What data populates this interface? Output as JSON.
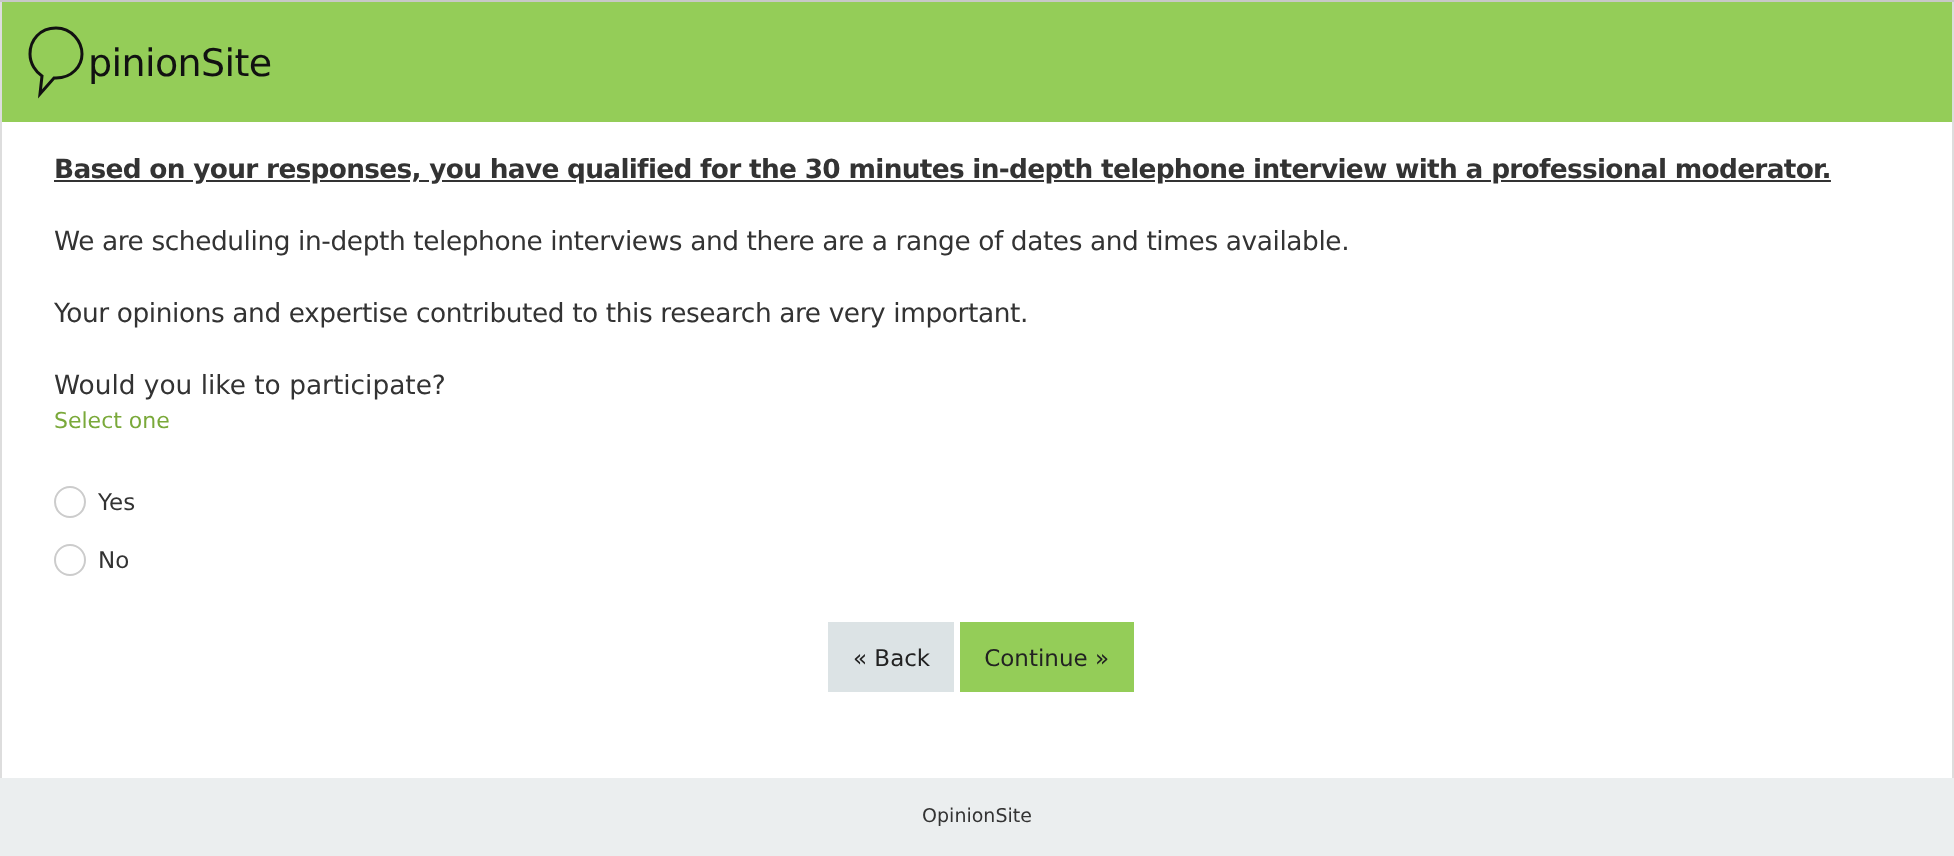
{
  "header": {
    "logo_text": "pinionSite"
  },
  "intro": "Based on your responses, you have qualified for the 30 minutes in-depth telephone interview with a professional moderator.",
  "paragraphs": [
    "We are scheduling in-depth telephone interviews and there are a range of dates and times available.",
    "Your opinions and expertise contributed to this research are very important."
  ],
  "question": {
    "text": "Would you like to participate?",
    "hint": "Select one",
    "options": [
      {
        "label": "Yes",
        "selected": false
      },
      {
        "label": "No",
        "selected": false
      }
    ]
  },
  "buttons": [
    {
      "kind": "back",
      "label": "« Back"
    },
    {
      "kind": "continue",
      "label": "Continue »"
    }
  ],
  "footer": "OpinionSite"
}
